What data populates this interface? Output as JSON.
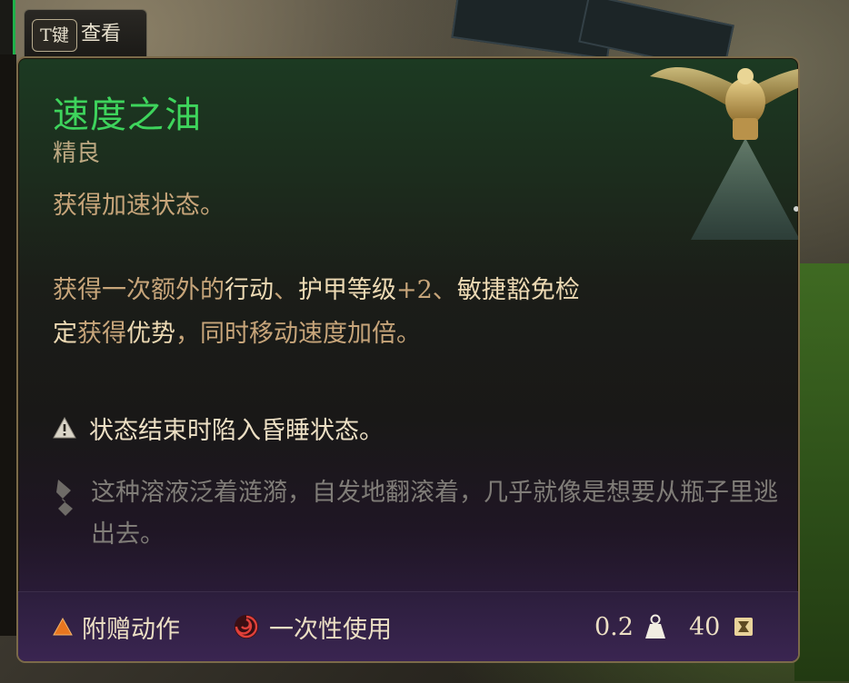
{
  "hint": {
    "key": "T键",
    "label": "查看"
  },
  "item": {
    "name": "速度之油",
    "rarity": "精良",
    "effect_line": "获得加速状态。",
    "effect_detail_parts": [
      "获得一次额外的",
      "行动",
      "、",
      "护甲等级",
      "+2、",
      "敏捷豁免检定",
      "获得",
      "优势",
      "，同时移动速度",
      "加倍。"
    ],
    "warning": "状态结束时陷入昏睡状态。",
    "lore": "这种溶液泛着涟漪，自发地翻滚着，几乎就像是想要从瓶子里逃出去。"
  },
  "footer": {
    "action_type": "附赠动作",
    "usage": "一次性使用",
    "weight": "0.2",
    "value": "40"
  },
  "icons": {
    "warning": "warning-triangle-icon",
    "lore": "lore-quill-icon",
    "action": "bonus-action-triangle-icon",
    "usage": "single-use-swirl-icon",
    "weight": "weight-icon",
    "gold": "gold-coin-icon"
  },
  "colors": {
    "title": "#3ed45c",
    "rarity": "#bda982",
    "body": "#c7a57a",
    "highlight": "#ecd9b3",
    "lore": "#807d78"
  }
}
